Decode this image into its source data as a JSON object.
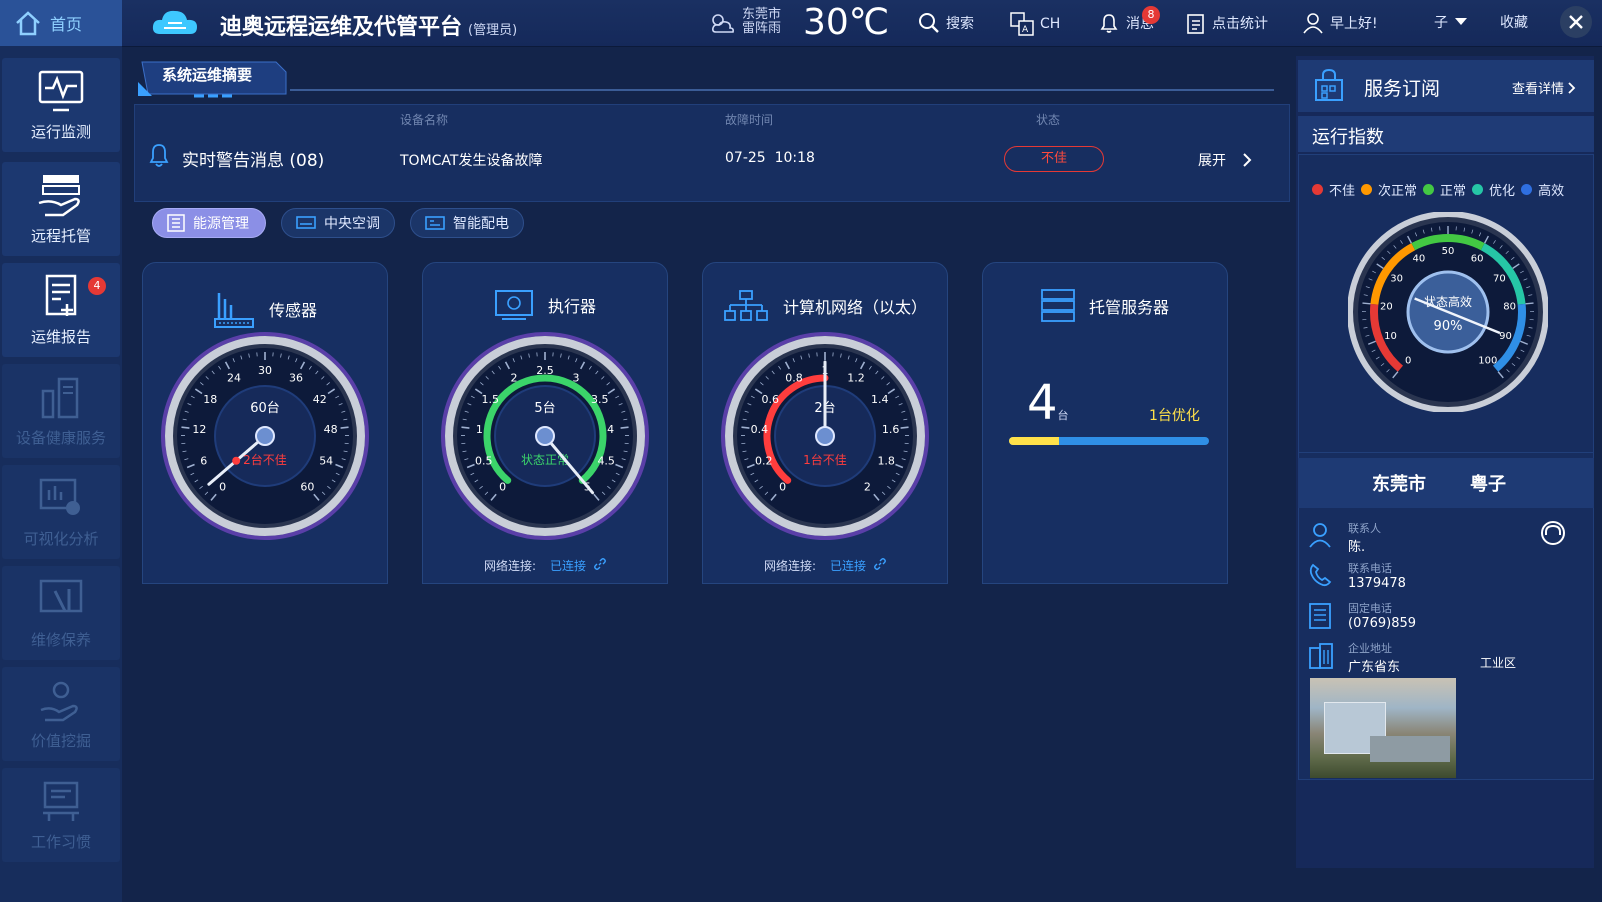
{
  "topbar": {
    "home_label": "首页",
    "app_title": "迪奥远程运维及代管平台",
    "role": "(管理员)",
    "weather_city": "东莞市",
    "weather_desc": "雷阵雨",
    "temperature": "30℃",
    "search_label": "搜索",
    "lang_label": "CH",
    "messages_label": "消息",
    "messages_count": "8",
    "stats_label": "点击统计",
    "greeting": "早上好!",
    "user_name": "子",
    "favorites_label": "收藏"
  },
  "sidebar": {
    "items": [
      {
        "label": "运行监测",
        "icon": "monitor-wave-icon"
      },
      {
        "label": "远程托管",
        "icon": "hand-server-icon"
      },
      {
        "label": "运维报告",
        "icon": "report-icon",
        "badge": "4"
      },
      {
        "label": "设备健康服务",
        "icon": "device-health-icon"
      },
      {
        "label": "可视化分析",
        "icon": "visual-analysis-icon"
      },
      {
        "label": "维修保养",
        "icon": "tools-icon"
      },
      {
        "label": "价值挖掘",
        "icon": "value-mining-icon"
      },
      {
        "label": "工作习惯",
        "icon": "work-habit-icon"
      }
    ]
  },
  "summary": {
    "section_title": "系统运维摘要",
    "col_device": "设备名称",
    "col_time": "故障时间",
    "col_status": "状态",
    "alert_label": "实时警告消息",
    "alert_count": "(08)",
    "device_name": "TOMCAT发生设备故障",
    "fault_time": "07-25  10:18",
    "status": "不佳",
    "expand_label": "展开"
  },
  "tabs": [
    {
      "label": "能源管理",
      "active": true
    },
    {
      "label": "中央空调",
      "active": false
    },
    {
      "label": "智能配电",
      "active": false
    }
  ],
  "cards": {
    "sensor": {
      "title": "传感器",
      "center": "60台",
      "sub": "2台不佳",
      "ticks": [
        "0",
        "6",
        "12",
        "18",
        "24",
        "30",
        "36",
        "42",
        "48",
        "54",
        "60"
      ],
      "max": 60,
      "needle": 2
    },
    "actuator": {
      "title": "执行器",
      "center": "5台",
      "sub": "状态正常",
      "ticks": [
        "0",
        "0.5",
        "1",
        "1.5",
        "2",
        "2.5",
        "3",
        "3.5",
        "4",
        "4.5",
        "5"
      ],
      "max": 5,
      "needle": 5,
      "arc": 5,
      "net_label": "网络连接:",
      "net_status": "已连接"
    },
    "network": {
      "title": "计算机网络（以太）",
      "center": "2台",
      "sub": "1台不佳",
      "ticks": [
        "0",
        "0.2",
        "0.4",
        "0.6",
        "0.8",
        "1",
        "1.2",
        "1.4",
        "1.6",
        "1.8",
        "2"
      ],
      "max": 2,
      "needle": 1,
      "arc": 1,
      "net_label": "网络连接:",
      "net_status": "已连接"
    },
    "server": {
      "title": "托管服务器",
      "count": "4",
      "unit": "台",
      "optimized": "1台优化",
      "fraction": 0.25
    }
  },
  "right": {
    "subscription_title": "服务订阅",
    "details_label": "查看详情",
    "index_title": "运行指数",
    "legend": [
      {
        "label": "不佳",
        "color": "#e53935"
      },
      {
        "label": "次正常",
        "color": "#ff9800"
      },
      {
        "label": "正常",
        "color": "#43c843"
      },
      {
        "label": "优化",
        "color": "#26c6a6"
      },
      {
        "label": "高效",
        "color": "#2f6fe0"
      }
    ],
    "gauge": {
      "ticks": [
        "0",
        "10",
        "20",
        "30",
        "40",
        "50",
        "60",
        "70",
        "80",
        "90",
        "100"
      ],
      "status": "状态高效",
      "percent": "90%",
      "value": 90
    },
    "company": {
      "city": "东莞市",
      "name": "粤子",
      "contact_label": "联系人",
      "contact_value": "陈.",
      "phone_label": "联系电话",
      "phone_value": "1379478",
      "landline_label": "固定电话",
      "landline_value": "(0769)859",
      "address_label": "企业地址",
      "address_value": "广东省东",
      "address_tail": "工业区"
    }
  }
}
